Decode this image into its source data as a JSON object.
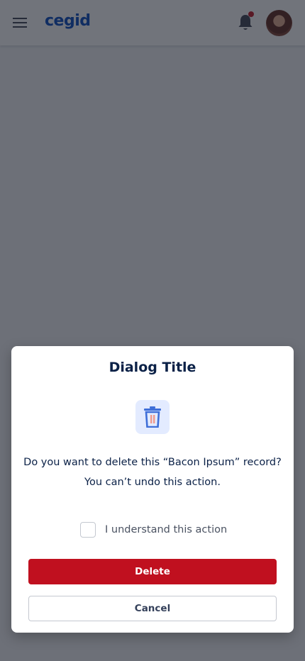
{
  "header": {
    "logo_text": "cegid",
    "menu_icon": "hamburger-menu-icon",
    "notification_icon": "bell-icon",
    "has_unread_notifications": true,
    "brand_color": "#0046be"
  },
  "dialog": {
    "title": "Dialog Title",
    "icon": "trash-icon",
    "message_line1": "Do you want to delete this “Bacon Ipsum” record?",
    "message_line2": "You can’t undo this action.",
    "checkbox_label": "I understand this action",
    "checkbox_checked": false,
    "delete_label": "Delete",
    "cancel_label": "Cancel",
    "danger_color": "#c0101f"
  }
}
